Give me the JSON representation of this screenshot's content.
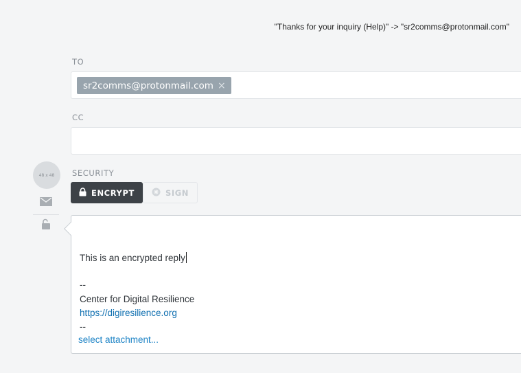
{
  "subject": "\"Thanks for your inquiry (Help)\" -> \"sr2comms@protonmail.com\"",
  "to": {
    "label": "TO",
    "recipients": [
      "sr2comms@protonmail.com"
    ],
    "remove_glyph": "×"
  },
  "cc": {
    "label": "CC"
  },
  "avatar": {
    "placeholder": "48 x 48"
  },
  "security": {
    "label": "SECURITY",
    "encrypt_label": "ENCRYPT",
    "sign_label": "SIGN"
  },
  "body": {
    "message": "This is an encrypted reply",
    "sig_separator_top": "--",
    "org_name": "Center for Digital Resilience",
    "org_url": "https://digiresilience.org",
    "sig_separator_bottom": "--"
  },
  "attachment": {
    "link_label": "select attachment..."
  },
  "colors": {
    "encrypt_active": "#3d4247",
    "token_bg": "#98a4ad",
    "link": "#1b82c5"
  }
}
